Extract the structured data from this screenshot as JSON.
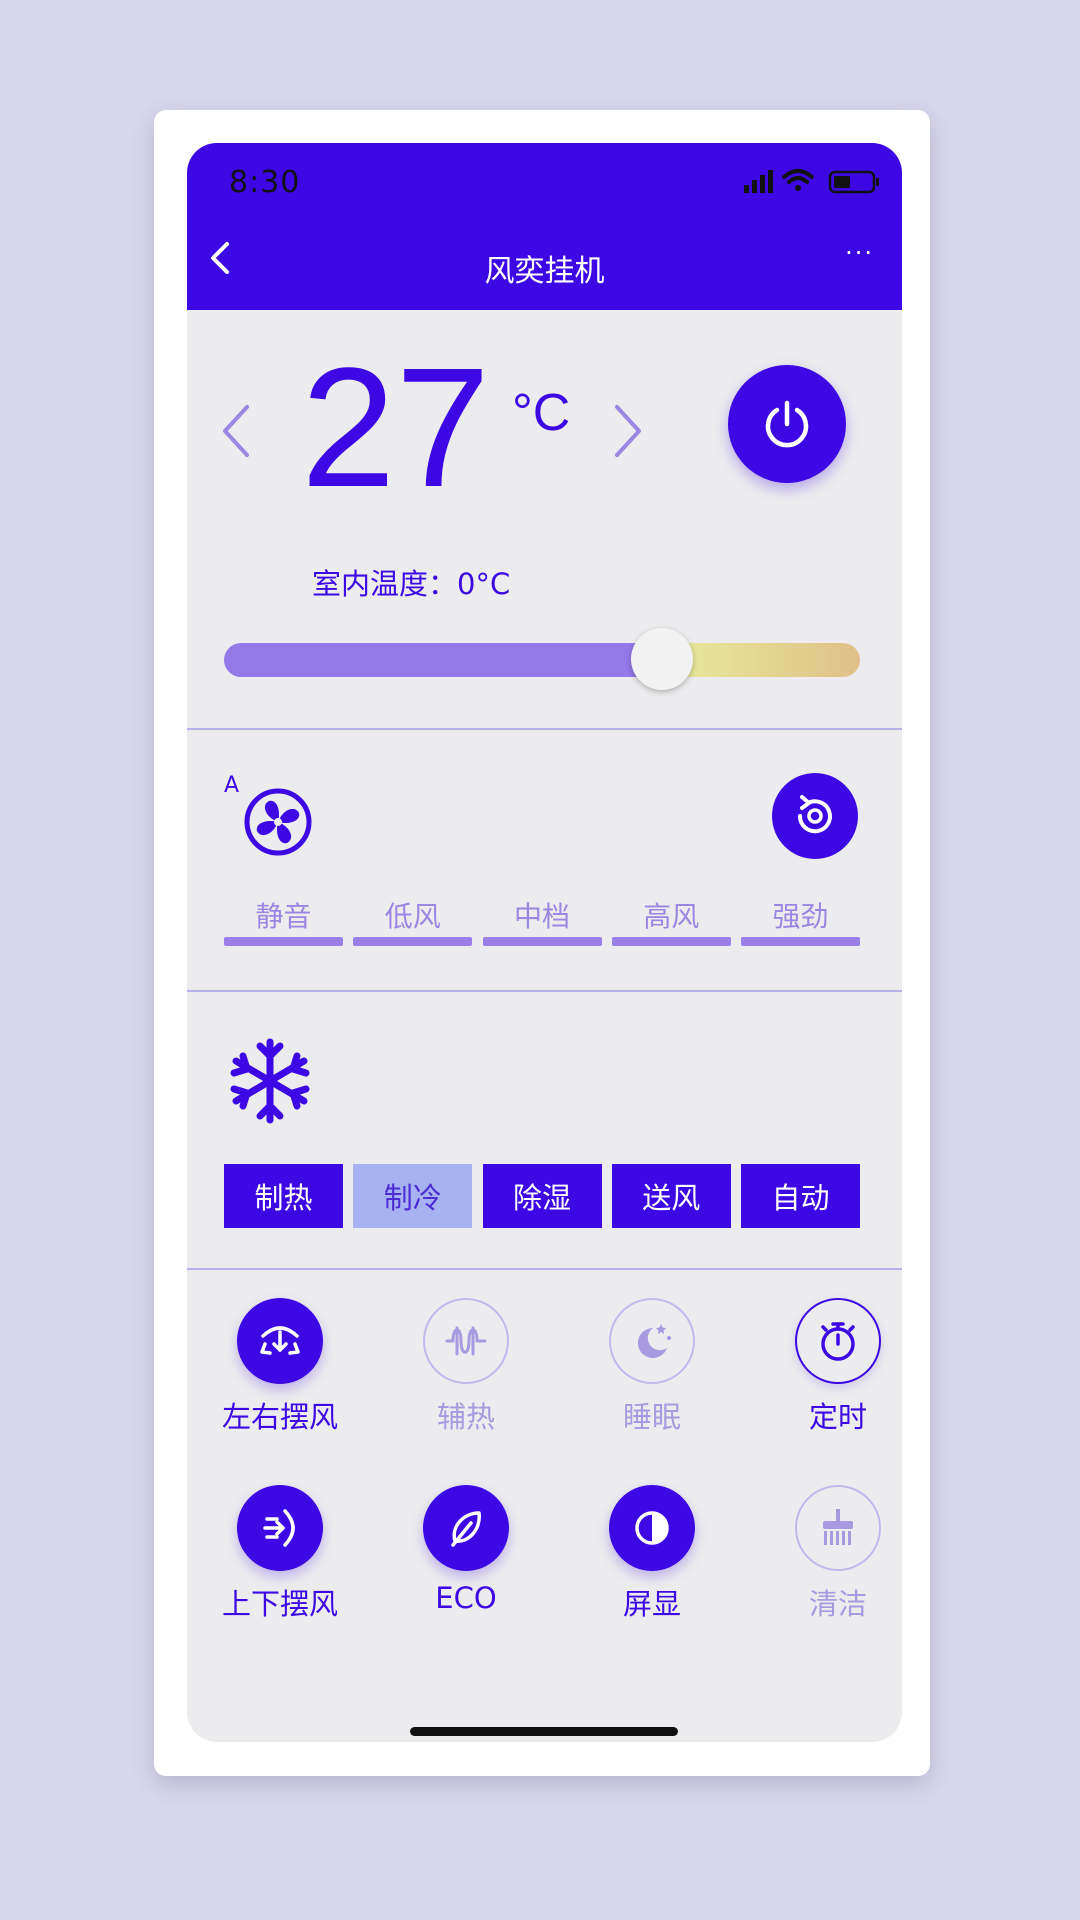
{
  "status": {
    "time": "8:30"
  },
  "nav": {
    "title": "风奕挂机",
    "more": "···"
  },
  "temperature": {
    "value": "27",
    "unit": "°C"
  },
  "indoor": {
    "text": "室内温度：0°C"
  },
  "slider": {
    "level_percent": 68
  },
  "fan": {
    "auto_label": "A",
    "speeds": [
      "静音",
      "低风",
      "中档",
      "高风",
      "强劲"
    ]
  },
  "modes": [
    {
      "label": "制热",
      "active": false
    },
    {
      "label": "制冷",
      "active": true
    },
    {
      "label": "除湿",
      "active": false
    },
    {
      "label": "送风",
      "active": false
    },
    {
      "label": "自动",
      "active": false
    }
  ],
  "functions": [
    {
      "label": "左右摆风",
      "icon": "swing-horizontal-icon",
      "state": "on"
    },
    {
      "label": "辅热",
      "icon": "aux-heat-icon",
      "state": "off"
    },
    {
      "label": "睡眠",
      "icon": "sleep-moon-icon",
      "state": "off"
    },
    {
      "label": "定时",
      "icon": "timer-icon",
      "state": "outline"
    },
    {
      "label": "上下摆风",
      "icon": "swing-vertical-icon",
      "state": "on"
    },
    {
      "label": "ECO",
      "icon": "eco-leaf-icon",
      "state": "on"
    },
    {
      "label": "屏显",
      "icon": "display-icon",
      "state": "on"
    },
    {
      "label": "清洁",
      "icon": "clean-brush-icon",
      "state": "off"
    }
  ],
  "colors": {
    "primary": "#3c08e3",
    "inactive": "#a89ae0",
    "mode_active_bg": "#a8b1f2"
  }
}
